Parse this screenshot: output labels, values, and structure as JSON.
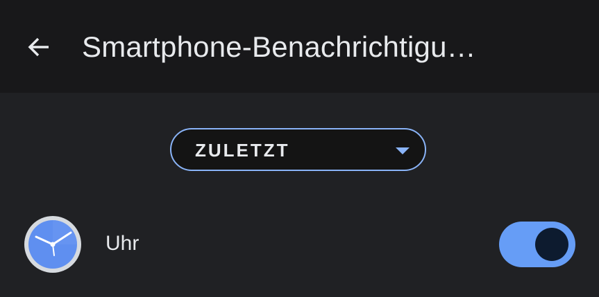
{
  "header": {
    "title": "Smartphone-Benachrichtigu…",
    "back_icon": "arrow-back-icon"
  },
  "filter": {
    "selected": "ZULETZT",
    "arrow_icon": "dropdown-arrow-icon"
  },
  "apps": [
    {
      "name": "Uhr",
      "icon": "clock-icon",
      "notifications_enabled": true
    }
  ],
  "colors": {
    "background": "#202124",
    "app_bar": "#18181a",
    "accent": "#8ab4f8",
    "toggle_on": "#669df6",
    "text": "#e8eaed"
  }
}
